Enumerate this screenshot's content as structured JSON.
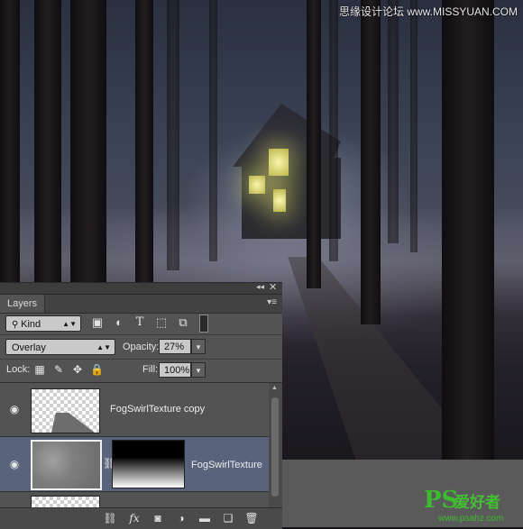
{
  "watermark": {
    "top_text": "思缘设计论坛 www.MISSYUAN.COM"
  },
  "logo": {
    "ps": "PS",
    "cn": "爱好者",
    "url": "www.psahz.com"
  },
  "panel": {
    "title": "Layers",
    "filter": {
      "kind_label": "Kind",
      "icons": [
        "image-filter-icon",
        "adjustment-filter-icon",
        "type-filter-icon",
        "shape-filter-icon",
        "smart-object-filter-icon"
      ]
    },
    "blend_mode": "Overlay",
    "opacity_label": "Opacity:",
    "opacity_value": "27%",
    "lock_label": "Lock:",
    "fill_label": "Fill:",
    "fill_value": "100%",
    "layers": [
      {
        "name": "FogSwirlTexture copy",
        "visible": true,
        "selected": false
      },
      {
        "name": "FogSwirlTexture",
        "visible": true,
        "selected": true,
        "has_mask": true
      }
    ]
  },
  "colors": {
    "panel_bg": "#535353",
    "selected_row": "#59637c",
    "logo_green": "#3dbb2e"
  }
}
